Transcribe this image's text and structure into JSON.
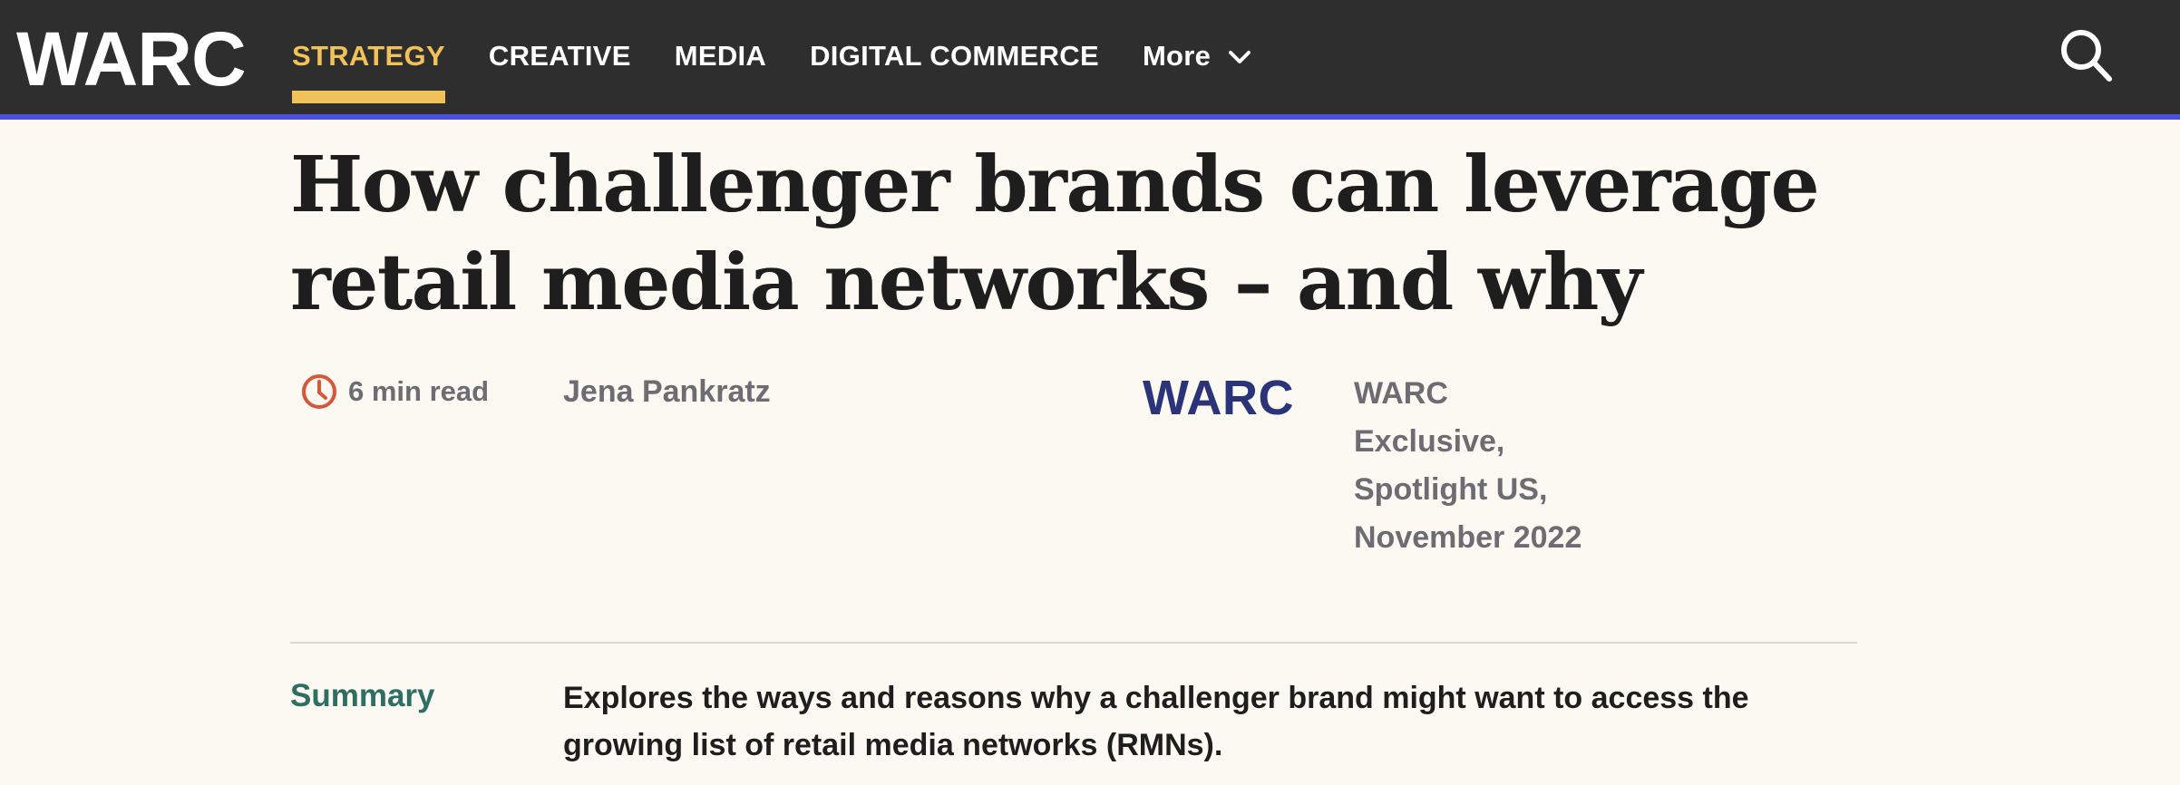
{
  "header": {
    "logo": "WARC",
    "nav": [
      {
        "label": "STRATEGY",
        "active": true
      },
      {
        "label": "CREATIVE",
        "active": false
      },
      {
        "label": "MEDIA",
        "active": false
      },
      {
        "label": "DIGITAL COMMERCE",
        "active": false
      }
    ],
    "more_label": "More",
    "more_icon": "chevron-down-icon",
    "search_icon": "search-icon",
    "colors": {
      "bar": "#2e2e2e",
      "active": "#f1c25a",
      "accent_rule": "#4a4fe0"
    }
  },
  "article": {
    "title": "How challenger brands can leverage retail media networks – and why",
    "read_time": "6 min read",
    "read_time_icon": "clock-icon",
    "author": "Jena Pankratz",
    "publisher_logo": "WARC",
    "source": "WARC Exclusive, Spotlight US, November 2022",
    "summary_label": "Summary",
    "summary": "Explores the ways and reasons why a challenger brand might want to access the growing list of retail media networks (RMNs).",
    "colors": {
      "background": "#fbf9f1",
      "summary_label": "#2f6e62",
      "clock": "#d7573a",
      "publisher_logo": "#2b3479"
    }
  }
}
